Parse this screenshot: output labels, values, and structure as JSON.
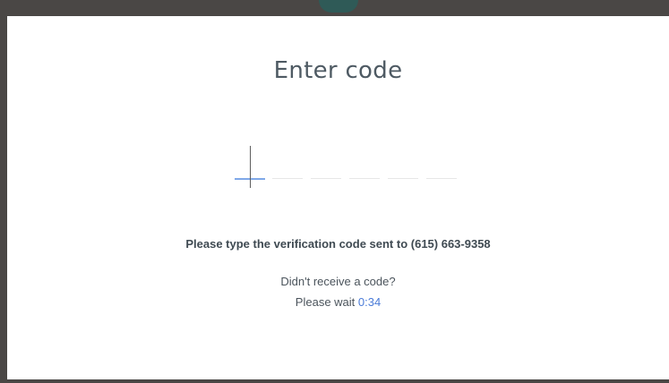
{
  "dialog": {
    "title": "Enter code",
    "code_length": 6,
    "instruction": "Please type the verification code sent to (615) 663-9358",
    "resend_question": "Didn't receive a code?",
    "wait_label": "Please wait ",
    "timer": "0:34"
  },
  "colors": {
    "background": "#4a4745",
    "panel": "#ffffff",
    "active_underline": "#7fa8e8",
    "inactive_underline": "#e6e6e6",
    "accent": "#4a7bd8",
    "title_text": "#4e5a63"
  }
}
